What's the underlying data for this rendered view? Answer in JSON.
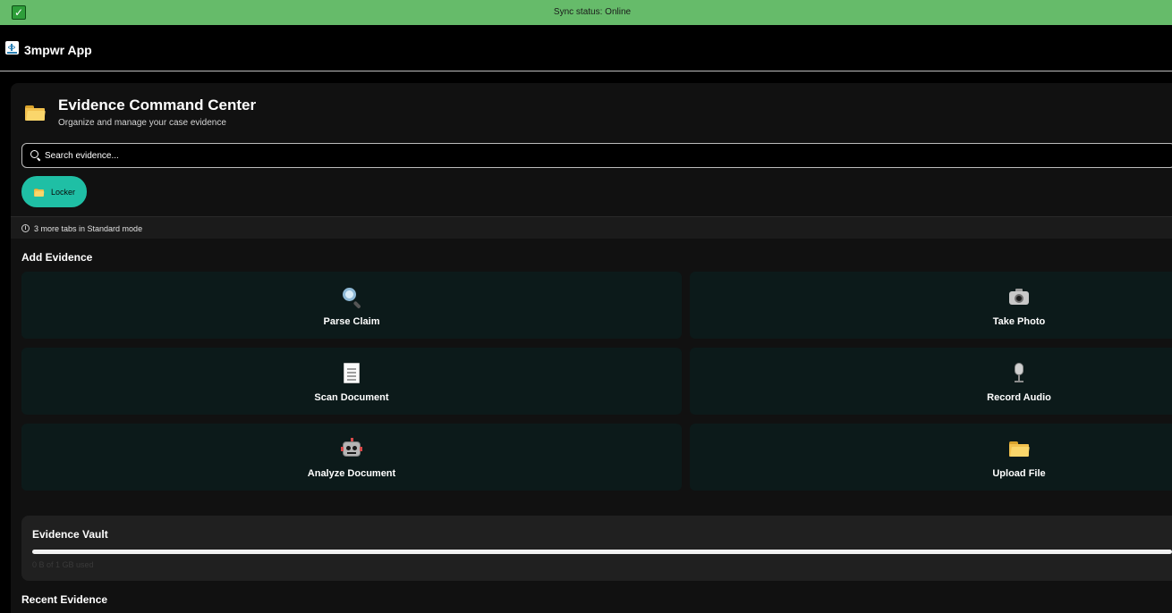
{
  "sync": {
    "status_text": "Sync status: Online",
    "checkbox_glyph": "✓",
    "color": "#66bb6a"
  },
  "app": {
    "title": "3mpwr App"
  },
  "hero": {
    "icon": "folder-icon",
    "title": "Evidence Command Center",
    "subtitle": "Organize and manage your case evidence"
  },
  "search": {
    "placeholder": "Search evidence...",
    "value": ""
  },
  "tabs": [
    {
      "label": "Locker",
      "icon": "folder-icon",
      "active": true,
      "color": "#1fbfa5"
    }
  ],
  "info": {
    "text": "3 more tabs in Standard mode",
    "icon_glyph": "i"
  },
  "add_evidence": {
    "title": "Add Evidence",
    "actions": [
      {
        "label": "Parse Claim",
        "icon": "magnifier-icon"
      },
      {
        "label": "Take Photo",
        "icon": "camera-icon"
      },
      {
        "label": "Scan Document",
        "icon": "document-icon"
      },
      {
        "label": "Record Audio",
        "icon": "microphone-icon"
      },
      {
        "label": "Analyze Document",
        "icon": "robot-icon"
      },
      {
        "label": "Upload File",
        "icon": "folder-icon"
      }
    ]
  },
  "vault": {
    "title": "Evidence Vault",
    "usage_fraction": 0,
    "caption": "0 B of 1 GB used"
  },
  "recent": {
    "title": "Recent Evidence"
  }
}
